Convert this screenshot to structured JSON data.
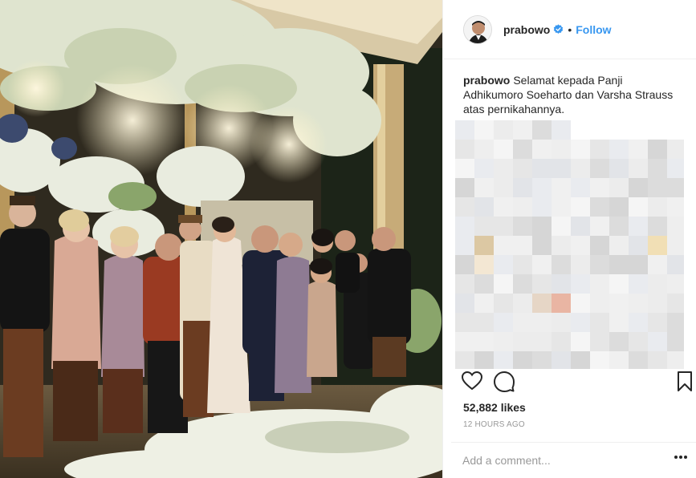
{
  "post": {
    "username": "prabowo",
    "follow_label": "Follow",
    "dot": "•",
    "caption_user": "prabowo",
    "caption_text": "Selamat kepada Panji Adhikumoro Soeharto dan Varsha Strauss atas pernikahannya.",
    "likes": "52,882 likes",
    "time_ago": "12 HOURS AGO",
    "comment_placeholder": "Add a comment..."
  },
  "icons": {
    "avatar": "avatar-portrait",
    "verified": "verified-badge-icon",
    "like": "heart-icon",
    "comment": "comment-icon",
    "save": "bookmark-icon",
    "more": "more-options-icon"
  },
  "colors": {
    "link": "#3897f0",
    "verified": "#3897f0",
    "muted": "#999999",
    "text": "#262626"
  }
}
